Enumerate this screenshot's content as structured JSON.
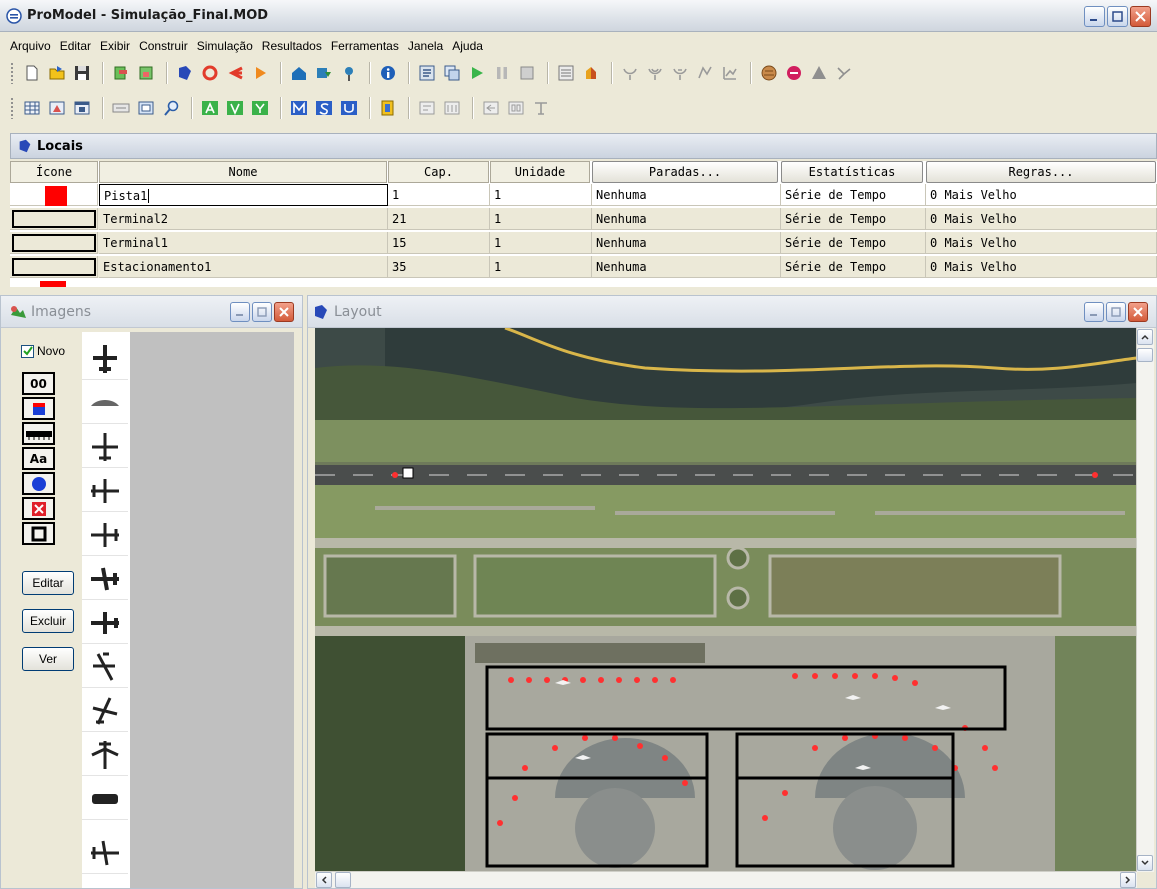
{
  "window": {
    "title": "ProModel - Simulação_Final.MOD"
  },
  "menu": [
    "Arquivo",
    "Editar",
    "Exibir",
    "Construir",
    "Simulação",
    "Resultados",
    "Ferramentas",
    "Janela",
    "Ajuda"
  ],
  "locais": {
    "panel_title": "Locais",
    "columns": {
      "icone": "Ícone",
      "nome": "Nome",
      "cap": "Cap.",
      "unidade": "Unidade",
      "paradas": "Paradas...",
      "estatisticas": "Estatísticas",
      "regras": "Regras..."
    },
    "rows": [
      {
        "nome": "Pista1",
        "cap": "1",
        "unidade": "1",
        "paradas": "Nenhuma",
        "estatisticas": "Série de Tempo",
        "regras": "0 Mais Velho"
      },
      {
        "nome": "Terminal2",
        "cap": "21",
        "unidade": "1",
        "paradas": "Nenhuma",
        "estatisticas": "Série de Tempo",
        "regras": "0 Mais Velho"
      },
      {
        "nome": "Terminal1",
        "cap": "15",
        "unidade": "1",
        "paradas": "Nenhuma",
        "estatisticas": "Série de Tempo",
        "regras": "0 Mais Velho"
      },
      {
        "nome": "Estacionamento1",
        "cap": "35",
        "unidade": "1",
        "paradas": "Nenhuma",
        "estatisticas": "Série de Tempo",
        "regras": "0 Mais Velho"
      }
    ]
  },
  "imagens": {
    "title": "Imagens",
    "novo_label": "Novo",
    "counter_label": "00",
    "text_tool_label": "Aa",
    "editar": "Editar",
    "excluir": "Excluir",
    "ver": "Ver"
  },
  "layout": {
    "title": "Layout"
  },
  "colors": {
    "accent_red": "#ff0000",
    "location_box": "#000000",
    "selection_blue": "#316ac5"
  }
}
